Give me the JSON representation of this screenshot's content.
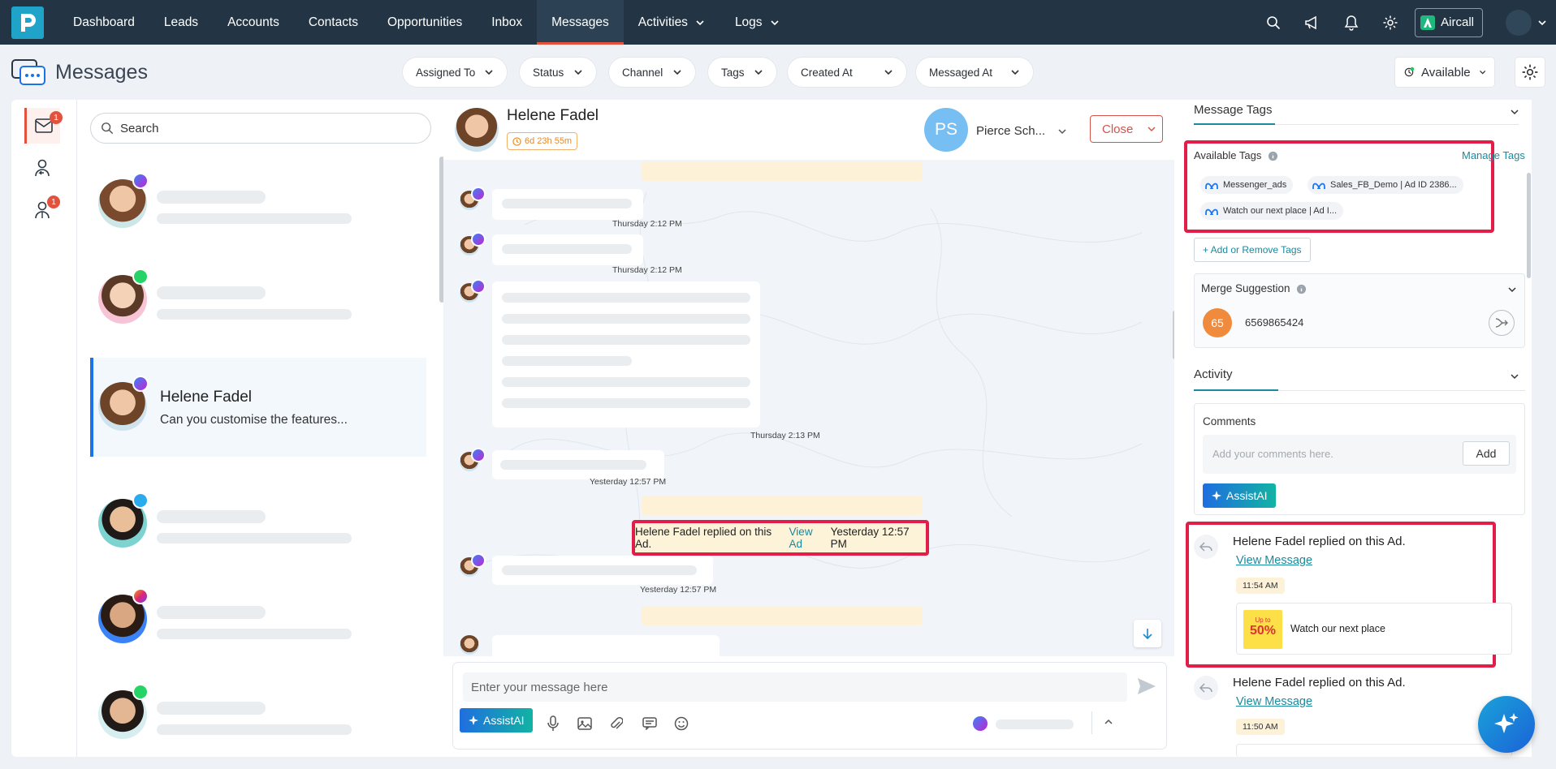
{
  "nav": {
    "items": [
      {
        "label": "Dashboard"
      },
      {
        "label": "Leads"
      },
      {
        "label": "Accounts"
      },
      {
        "label": "Contacts"
      },
      {
        "label": "Opportunities"
      },
      {
        "label": "Inbox"
      },
      {
        "label": "Messages",
        "active": true
      },
      {
        "label": "Activities",
        "dropdown": true
      },
      {
        "label": "Logs",
        "dropdown": true
      }
    ],
    "aircall_label": "Aircall"
  },
  "page": {
    "title": "Messages",
    "filters": [
      "Assigned To",
      "Status",
      "Channel",
      "Tags",
      "Created At",
      "Messaged At"
    ],
    "availability": "Available"
  },
  "rail": {
    "messages_badge": "1",
    "agent_badge": "1"
  },
  "list": {
    "search_placeholder": "Search",
    "selected": {
      "name": "Helene Fadel",
      "preview": "Can you customise the features..."
    }
  },
  "chat": {
    "contact_name": "Helene Fadel",
    "timer": "6d 23h 55m",
    "assignee_initials": "PS",
    "assignee_name": "Pierce Sch...",
    "close_label": "Close",
    "timestamps": [
      "Thursday 2:12 PM",
      "Thursday 2:12 PM",
      "Thursday 2:13 PM",
      "Yesterday 12:57 PM",
      "Yesterday 12:57 PM"
    ],
    "system_message": {
      "text": "Helene Fadel replied on this Ad.",
      "link": "View Ad",
      "time": "Yesterday 12:57 PM"
    },
    "composer_placeholder": "Enter your message here",
    "assist_label": "AssistAI"
  },
  "right": {
    "message_tags_title": "Message Tags",
    "available_tags_label": "Available Tags",
    "manage_tags_label": "Manage Tags",
    "tags": [
      "Messenger_ads",
      "Sales_FB_Demo | Ad ID 2386...",
      "Watch our next place | Ad I..."
    ],
    "add_remove_tags_label": "+ Add or Remove Tags",
    "merge_title": "Merge Suggestion",
    "merge_score": "65",
    "merge_phone": "6569865424",
    "activity_title": "Activity",
    "comments_label": "Comments",
    "comments_placeholder": "Add your comments here.",
    "add_label": "Add",
    "assist_label": "AssistAI",
    "activities": [
      {
        "title": "Helene Fadel replied on this Ad.",
        "link": "View Message",
        "time": "11:54 AM",
        "ad_badge_top": "Up to",
        "ad_badge_value": "50%",
        "ad_title": "Watch our next place"
      },
      {
        "title": "Helene Fadel replied on this Ad.",
        "link": "View Message",
        "time": "11:50 AM"
      }
    ]
  },
  "colors": {
    "nav_bg": "#233544",
    "accent_red": "#e3523d",
    "highlight_red": "#e11d48",
    "link_teal": "#1a8a9e",
    "blue": "#1a73e8"
  }
}
